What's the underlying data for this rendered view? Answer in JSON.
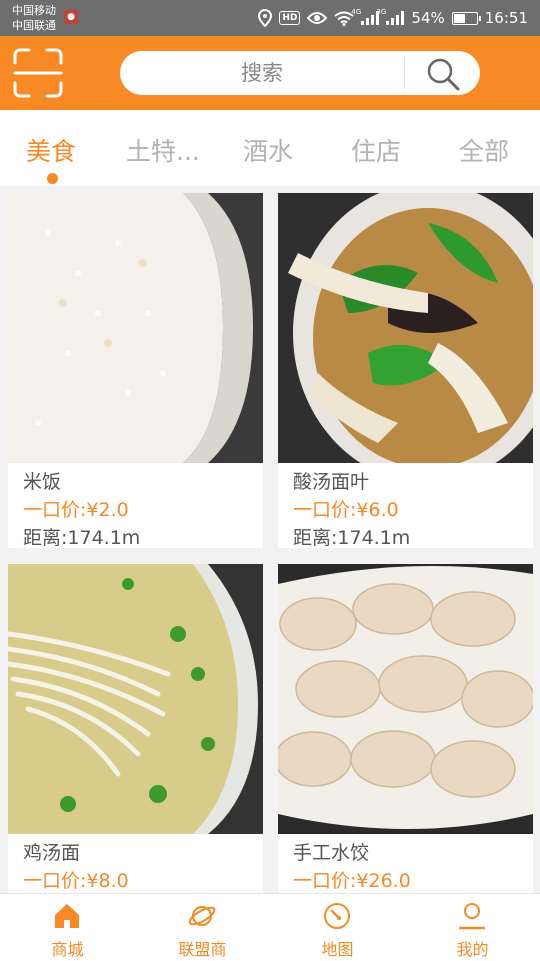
{
  "status_bar": {
    "carrier_1": "中国移动",
    "carrier_2": "中国联通",
    "hd_label": "HD",
    "net_1": "4G",
    "net_2": "3G",
    "battery_text": "54%",
    "battery_level": 0.54,
    "time": "16:51"
  },
  "header": {
    "search_placeholder": "搜索"
  },
  "tabs": [
    {
      "label": "美食",
      "active": true
    },
    {
      "label": "土特...",
      "active": false
    },
    {
      "label": "酒水",
      "active": false
    },
    {
      "label": "住店",
      "active": false
    },
    {
      "label": "全部",
      "active": false
    }
  ],
  "products": [
    {
      "name": "米饭",
      "price": "一口价:¥2.0",
      "distance": "距离:174.1m",
      "image": "rice-bowl"
    },
    {
      "name": "酸汤面叶",
      "price": "一口价:¥6.0",
      "distance": "距离:174.1m",
      "image": "sour-soup-noodle"
    },
    {
      "name": "鸡汤面",
      "price": "一口价:¥8.0",
      "distance": "",
      "image": "chicken-noodle-soup"
    },
    {
      "name": "手工水饺",
      "price": "一口价:¥26.0",
      "distance": "",
      "image": "dumplings"
    }
  ],
  "bottom_nav": [
    {
      "label": "商城",
      "icon": "home-icon"
    },
    {
      "label": "联盟商",
      "icon": "planet-icon"
    },
    {
      "label": "地图",
      "icon": "compass-icon"
    },
    {
      "label": "我的",
      "icon": "user-icon"
    }
  ],
  "colors": {
    "accent": "#f78a25",
    "status_bar": "#6e6e6e",
    "tab_inactive": "#b3b3b3",
    "background": "#f2f2f2"
  }
}
